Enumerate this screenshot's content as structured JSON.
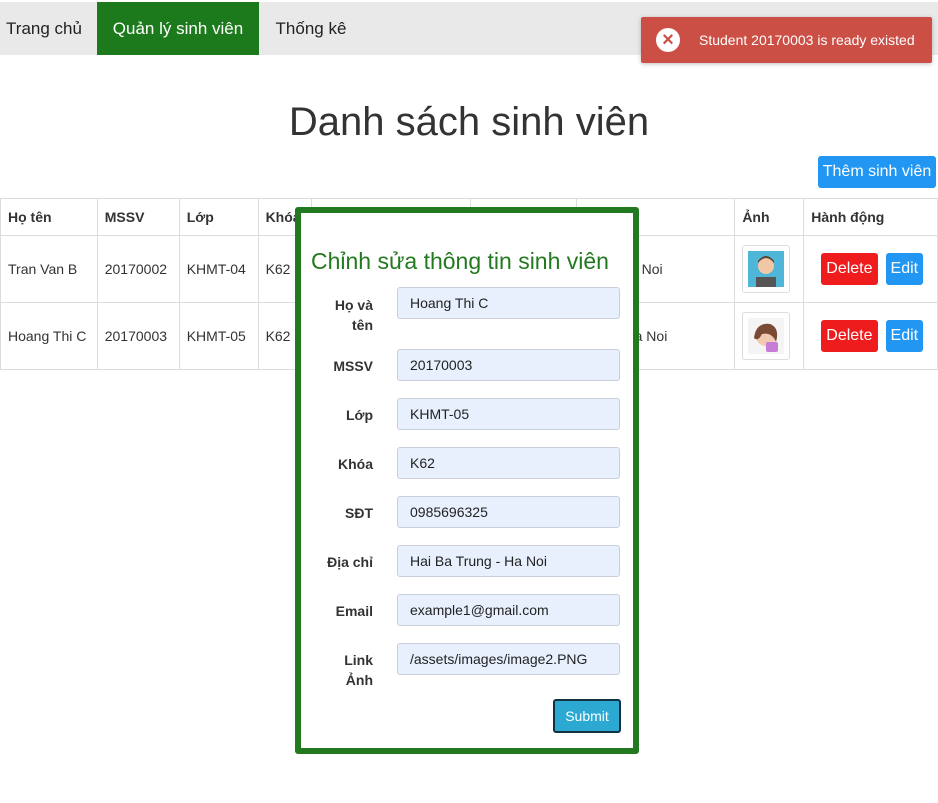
{
  "nav": {
    "items": [
      "Trang chủ",
      "Quản lý sinh viên",
      "Thống kê"
    ]
  },
  "toast": {
    "icon": "close-circle-icon",
    "message": "Student 20170003 is ready existed",
    "color": "#cc4f45"
  },
  "page": {
    "title": "Danh sách sinh viên",
    "add_button": "Thêm sinh viên"
  },
  "table": {
    "headers": [
      "Họ tên",
      "MSSV",
      "Lớp",
      "Khóa",
      "",
      "",
      "",
      "Ảnh",
      "Hành động"
    ],
    "rows": [
      {
        "name": "Tran Van B",
        "mssv": "20170002",
        "lop": "KHMT-04",
        "khoa": "K62",
        "address": "uan - Ha Noi",
        "avatar": "avatar-male-icon"
      },
      {
        "name": "Hoang Thi C",
        "mssv": "20170003",
        "lop": "KHMT-05",
        "khoa": "K62",
        "address": "rung - Ha Noi",
        "avatar": "avatar-female-icon"
      }
    ],
    "delete_label": "Delete",
    "edit_label": "Edit"
  },
  "modal": {
    "title": "Chỉnh sửa thông tin sinh viên",
    "fields": [
      {
        "label": "Họ và tên",
        "value": "Hoang Thi C"
      },
      {
        "label": "MSSV",
        "value": "20170003"
      },
      {
        "label": "Lớp",
        "value": "KHMT-05"
      },
      {
        "label": "Khóa",
        "value": "K62"
      },
      {
        "label": "SĐT",
        "value": "0985696325"
      },
      {
        "label": "Địa chỉ",
        "value": "Hai Ba Trung - Ha Noi"
      },
      {
        "label": "Email",
        "value": "example1@gmail.com"
      },
      {
        "label": "Link Ảnh",
        "value": "/assets/images/image2.PNG"
      }
    ],
    "submit": "Submit"
  },
  "colors": {
    "nav_active": "#1c7a1c",
    "modal_border": "#23791f",
    "primary_button": "#2196f3",
    "delete_button": "#ee1c1c",
    "submit_button": "#2ba9d3"
  }
}
